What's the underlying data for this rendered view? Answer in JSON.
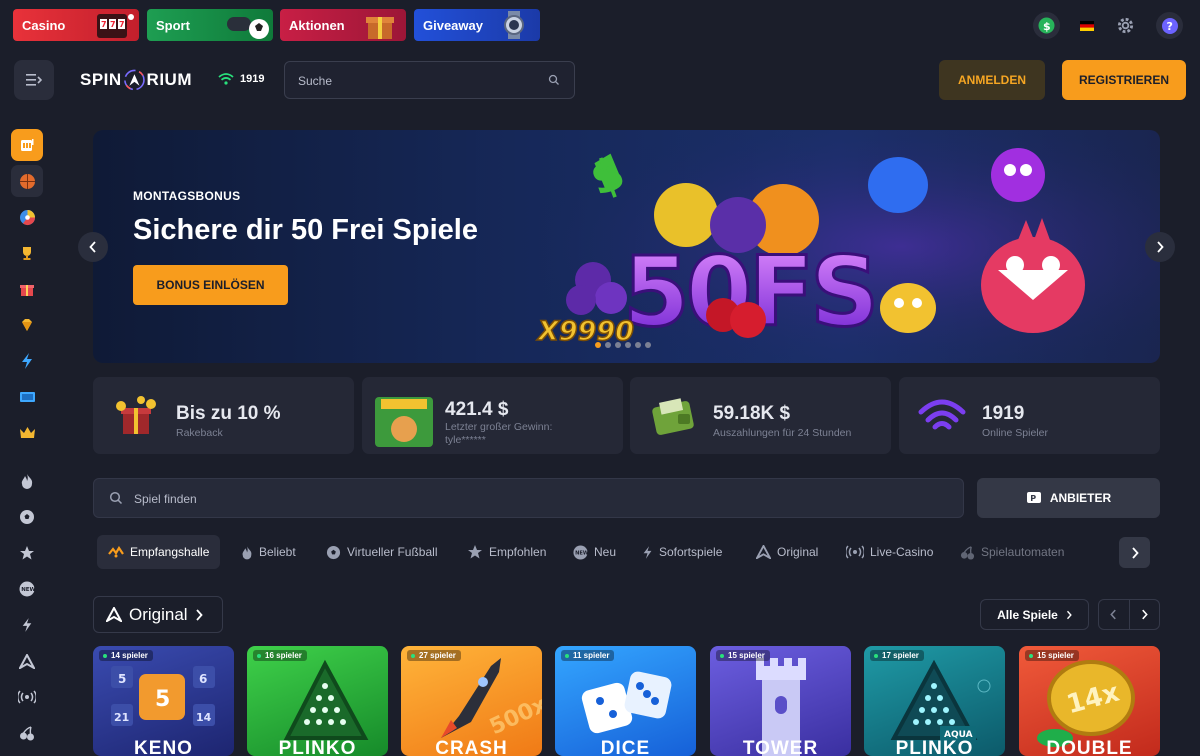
{
  "top_tabs": [
    {
      "label": "Casino"
    },
    {
      "label": "Sport"
    },
    {
      "label": "Aktionen"
    },
    {
      "label": "Giveaway"
    }
  ],
  "logo": {
    "text_left": "SPIN",
    "text_right": "RIUM"
  },
  "online_count": "1919",
  "search": {
    "placeholder": "Suche"
  },
  "auth": {
    "login": "ANMELDEN",
    "register": "REGISTRIEREN"
  },
  "sidebar_icons": [
    "casino-icon",
    "basketball-icon",
    "pie-chart-icon",
    "trophy-icon",
    "gift-icon",
    "gem-icon",
    "lightning-icon",
    "ticket-icon",
    "crown-icon",
    "fire-icon",
    "football-icon",
    "star-icon",
    "new-icon",
    "lightning-icon",
    "spinarium-icon",
    "live-icon",
    "cherry-icon"
  ],
  "banner": {
    "kicker": "MONTAGSBONUS",
    "headline": "Sichere dir 50 Frei Spiele",
    "cta": "BONUS EINLÖSEN",
    "promo_art": "50FS",
    "multiplier": "X9990",
    "slide_count": 6,
    "active_slide": 1
  },
  "stats": [
    {
      "value": "Bis zu 10 %",
      "label": "Rakeback"
    },
    {
      "value": "421.4 $",
      "label": "Letzter großer Gewinn:",
      "label2": "tyle******"
    },
    {
      "value": "59.18K $",
      "label": "Auszahlungen für 24 Stunden"
    },
    {
      "value": "1919",
      "label": "Online Spieler"
    }
  ],
  "game_search": {
    "placeholder": "Spiel finden"
  },
  "provider_button": "ANBIETER",
  "categories": [
    {
      "label": "Empfangshalle",
      "active": true
    },
    {
      "label": "Beliebt"
    },
    {
      "label": "Virtueller Fußball"
    },
    {
      "label": "Empfohlen"
    },
    {
      "label": "Neu"
    },
    {
      "label": "Sofortspiele"
    },
    {
      "label": "Original"
    },
    {
      "label": "Live-Casino"
    },
    {
      "label": "Spielautomaten"
    }
  ],
  "section": {
    "title": "Original",
    "all_games": "Alle Spiele"
  },
  "games": [
    {
      "name": "KENO",
      "players": "14 spieler"
    },
    {
      "name": "PLINKO",
      "players": "16 spieler"
    },
    {
      "name": "CRASH",
      "players": "27 spieler"
    },
    {
      "name": "DICE",
      "players": "11 spieler"
    },
    {
      "name": "TOWER",
      "players": "15 spieler"
    },
    {
      "name": "PLINKO",
      "players": "17 spieler",
      "badge": "AQUA"
    },
    {
      "name": "DOUBLE",
      "players": "15 spieler"
    }
  ],
  "colors": {
    "accent": "#f89c1c",
    "bg": "#1b1e2a",
    "card": "#252836"
  }
}
